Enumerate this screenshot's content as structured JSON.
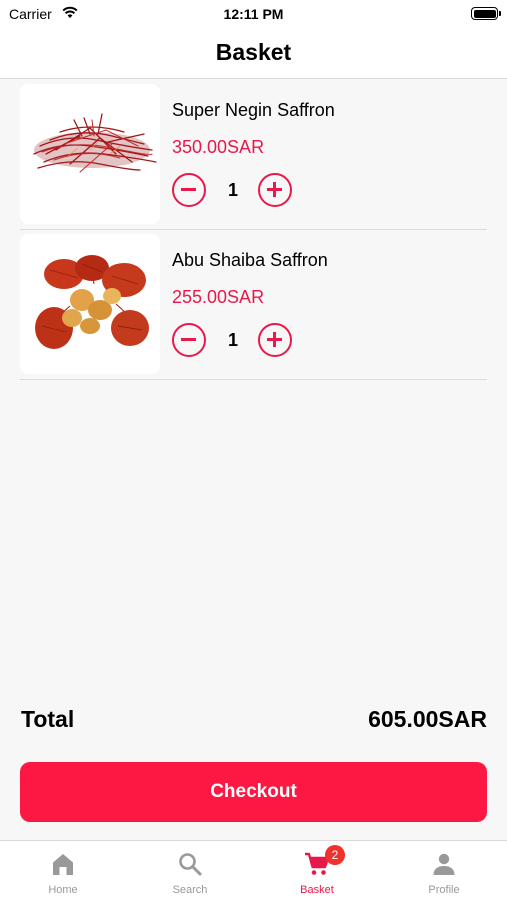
{
  "status_bar": {
    "carrier": "Carrier",
    "time": "12:11 PM"
  },
  "header": {
    "title": "Basket"
  },
  "items": [
    {
      "name": "Super Negin Saffron",
      "price": "350.00SAR",
      "quantity": "1"
    },
    {
      "name": "Abu Shaiba Saffron",
      "price": "255.00SAR",
      "quantity": "1"
    }
  ],
  "total": {
    "label": "Total",
    "value": "605.00SAR"
  },
  "checkout": {
    "label": "Checkout"
  },
  "tabs": [
    {
      "label": "Home",
      "icon": "home-icon"
    },
    {
      "label": "Search",
      "icon": "search-icon"
    },
    {
      "label": "Basket",
      "icon": "cart-icon",
      "badge": "2",
      "active": true
    },
    {
      "label": "Profile",
      "icon": "person-icon"
    }
  ],
  "colors": {
    "accent": "#e8194a",
    "checkout": "#fd1843",
    "badge": "#f0322f",
    "inactive_tab": "#999999"
  }
}
